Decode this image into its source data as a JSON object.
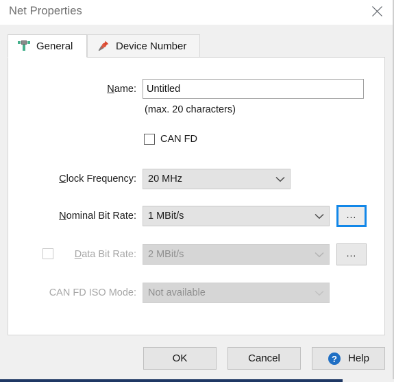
{
  "window": {
    "title": "Net Properties",
    "close_icon": "close-icon",
    "accent_focus_color": "#1287e8"
  },
  "tabs": [
    {
      "id": "general",
      "label": "General",
      "icon": "net-icon",
      "active": true
    },
    {
      "id": "device-number",
      "label": "Device Number",
      "icon": "pushpin-icon",
      "active": false
    }
  ],
  "form": {
    "name": {
      "label_prefix": "N",
      "label_rest": "ame:",
      "value": "Untitled",
      "placeholder": "",
      "hint": "(max. 20 characters)"
    },
    "can_fd": {
      "label": "CAN FD",
      "checked": false
    },
    "clock_frequency": {
      "label_prefix": "C",
      "label_rest": "lock Frequency:",
      "value": "20 MHz",
      "arrow_icon": "chevron-down-icon",
      "enabled": true
    },
    "nominal_bit_rate": {
      "label_prefix": "N",
      "label_rest": "ominal Bit Rate:",
      "value": "1 MBit/s",
      "arrow_icon": "chevron-down-icon",
      "browse_label": "...",
      "enabled": true,
      "focused": true
    },
    "data_bit_rate": {
      "label_prefix": "D",
      "label_rest": "ata Bit Rate:",
      "value": "2 MBit/s",
      "arrow_icon": "chevron-down-icon",
      "browse_label": "...",
      "checked": false,
      "enabled": false
    },
    "can_fd_iso_mode": {
      "label": "CAN FD ISO Mode:",
      "value": "Not available",
      "arrow_icon": "chevron-down-icon",
      "enabled": false
    }
  },
  "footer": {
    "ok": "OK",
    "cancel": "Cancel",
    "help": "Help",
    "help_icon": "question-circle-icon"
  }
}
